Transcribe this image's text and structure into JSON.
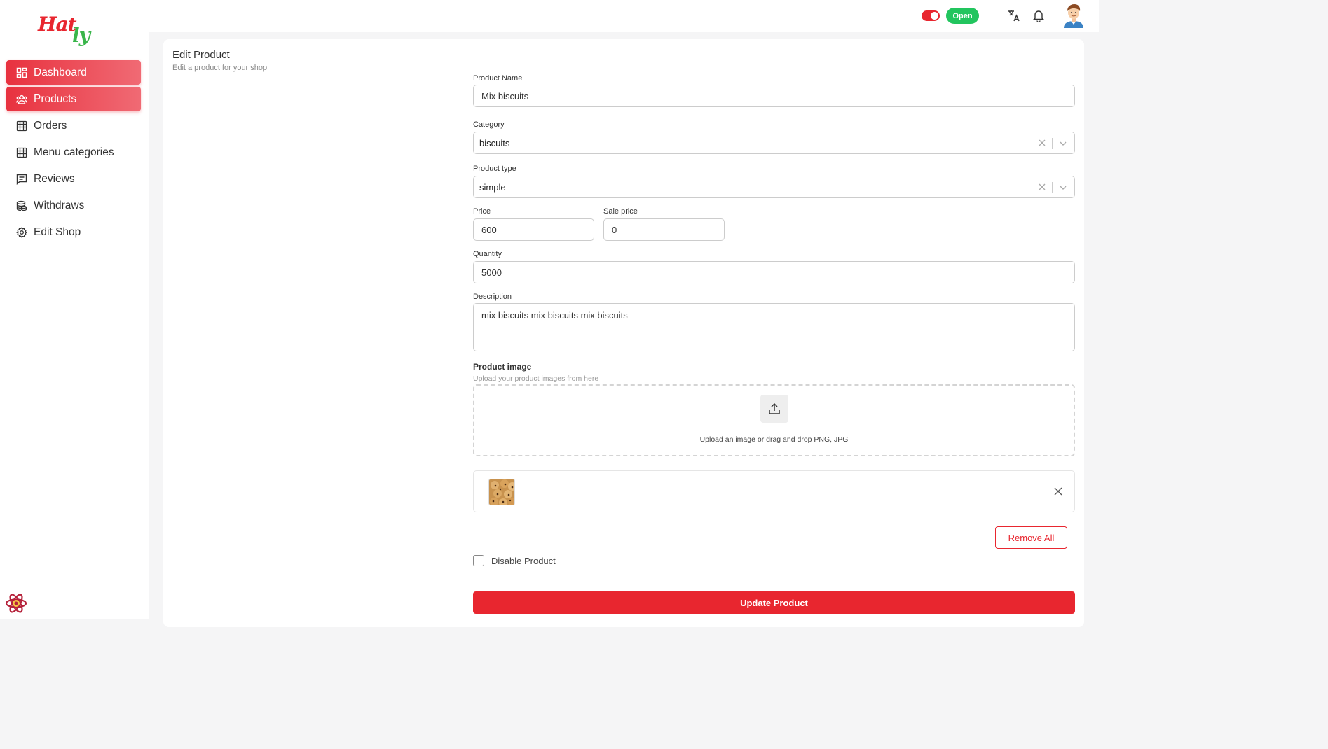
{
  "brand": {
    "logo_part1": "Hat",
    "logo_part2": "ly"
  },
  "sidebar": {
    "items": [
      {
        "label": "Dashboard",
        "icon": "dashboard-icon",
        "active": true
      },
      {
        "label": "Products",
        "icon": "users-icon",
        "active": true
      },
      {
        "label": "Orders",
        "icon": "store-icon",
        "active": false
      },
      {
        "label": "Menu categories",
        "icon": "store-icon",
        "active": false
      },
      {
        "label": "Reviews",
        "icon": "message-icon",
        "active": false
      },
      {
        "label": "Withdraws",
        "icon": "coins-icon",
        "active": false
      },
      {
        "label": "Edit Shop",
        "icon": "gear-icon",
        "active": false
      }
    ]
  },
  "topbar": {
    "status": "Open",
    "toggle_on": true
  },
  "page": {
    "title": "Edit Product",
    "subtitle": "Edit a product for your shop"
  },
  "form": {
    "product_name_label": "Product Name",
    "product_name": "Mix biscuits",
    "category_label": "Category",
    "category": "biscuits",
    "type_label": "Product type",
    "type": "simple",
    "price_label": "Price",
    "price": "600",
    "sale_price_label": "Sale price",
    "sale_price": "0",
    "quantity_label": "Quantity",
    "quantity": "5000",
    "description_label": "Description",
    "description": "mix biscuits mix biscuits mix biscuits",
    "image_title": "Product image",
    "image_subtitle": "Upload your product images from here",
    "upload_text": "Upload an image or drag and drop PNG, JPG",
    "remove_all": "Remove All",
    "disable_label": "Disable Product",
    "disable_checked": false,
    "submit": "Update Product"
  },
  "colors": {
    "accent": "#e8262f",
    "success": "#22c55e",
    "logo_green": "#39b54a"
  }
}
